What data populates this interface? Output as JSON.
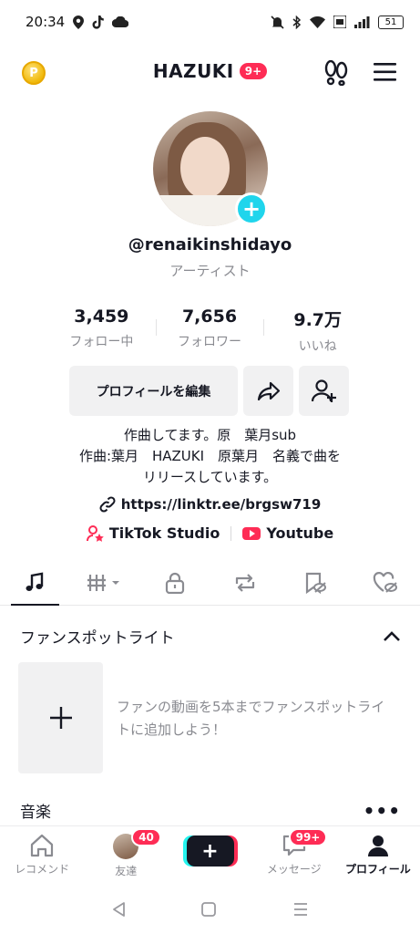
{
  "status": {
    "time": "20:34",
    "battery": "51"
  },
  "header": {
    "title": "HAZUKI",
    "badge": "9+"
  },
  "profile": {
    "username": "@renaikinshidayo",
    "subtitle": "アーティスト"
  },
  "stats": [
    {
      "value": "3,459",
      "label": "フォロー中"
    },
    {
      "value": "7,656",
      "label": "フォロワー"
    },
    {
      "value": "9.7万",
      "label": "いいね"
    }
  ],
  "buttons": {
    "edit_profile": "プロフィールを編集"
  },
  "bio": {
    "line1": "作曲してます。原　葉月sub",
    "line2": "作曲:葉月　HAZUKI　原葉月　名義で曲を",
    "line3": "リリースしています。"
  },
  "link": "https://linktr.ee/brgsw719",
  "pills": {
    "studio": "TikTok Studio",
    "youtube": "Youtube"
  },
  "fans": {
    "title": "ファンスポットライト",
    "text": "ファンの動画を5本までファンスポットライトに追加しよう！"
  },
  "music": {
    "title": "音楽"
  },
  "bottom_nav": {
    "home": "レコメンド",
    "friends": "友達",
    "friends_badge": "40",
    "messages": "メッセージ",
    "messages_badge": "99+",
    "profile": "プロフィール"
  },
  "colors": {
    "accent": "#fe2c55",
    "teal": "#20d5ec",
    "text": "#161823",
    "muted": "#8a8b91"
  }
}
